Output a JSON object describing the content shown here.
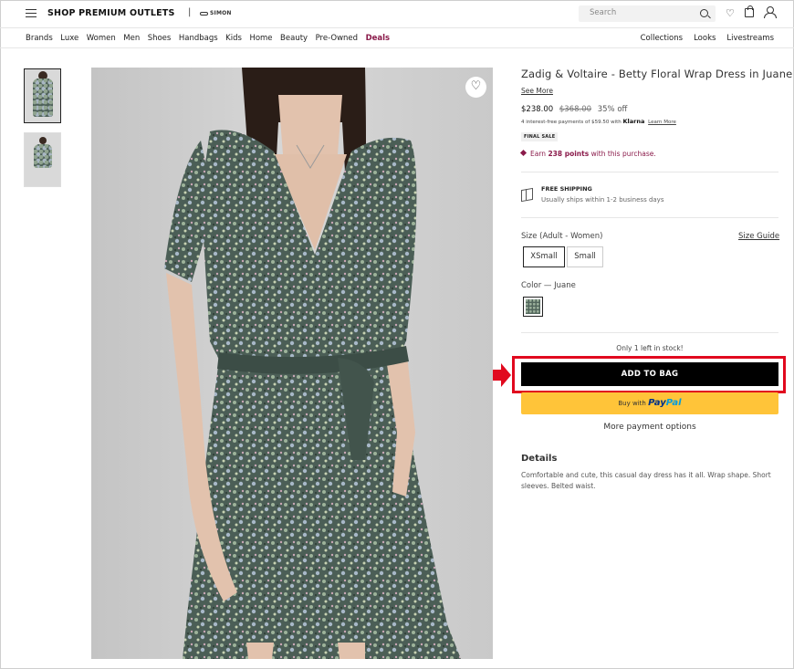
{
  "header": {
    "logo": "SHOP PREMIUM OUTLETS",
    "separator": "|",
    "partner": "SIMON",
    "search_placeholder": "Search"
  },
  "nav": {
    "left": [
      "Brands",
      "Luxe",
      "Women",
      "Men",
      "Shoes",
      "Handbags",
      "Kids",
      "Home",
      "Beauty",
      "Pre-Owned",
      "Deals"
    ],
    "right": [
      "Collections",
      "Looks",
      "Livestreams"
    ]
  },
  "product": {
    "title": "Zadig & Voltaire - Betty Floral Wrap Dress in Juane",
    "see_more": "See More",
    "price": "$238.00",
    "original_price": "$368.00",
    "discount": "35% off",
    "klarna_text": "4 interest-free payments of $59.50 with",
    "klarna_brand": "Klarna",
    "klarna_link": "Learn More",
    "final_sale": "FINAL SALE",
    "points_prefix": "Earn",
    "points_value": "238 points",
    "points_suffix": "with this purchase.",
    "shipping_title": "FREE SHIPPING",
    "shipping_sub": "Usually ships within 1-2 business days",
    "size_label": "Size (Adult - Women)",
    "size_guide": "Size Guide",
    "sizes": [
      "XSmall",
      "Small"
    ],
    "selected_size": "XSmall",
    "color_label": "Color — Juane",
    "stock": "Only 1 left in stock!",
    "add_to_bag": "ADD TO BAG",
    "paypal_prefix": "Buy with",
    "paypal_brand_a": "Pay",
    "paypal_brand_b": "Pal",
    "more_payment": "More payment options",
    "details_heading": "Details",
    "details_text": "Comfortable and cute, this casual day dress has it all. Wrap shape. Short sleeves. Belted waist."
  },
  "colors": {
    "accent": "#8a1a4a",
    "highlight": "#e1091e",
    "paypal": "#ffc439",
    "button": "#000000"
  }
}
